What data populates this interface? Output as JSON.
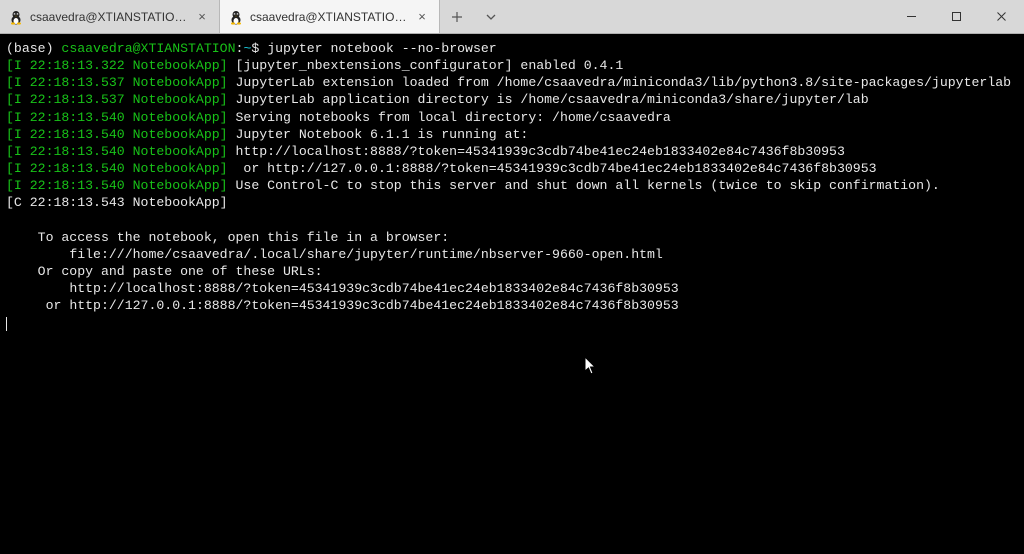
{
  "tabs": {
    "t0": {
      "title": "csaavedra@XTIANSTATION: /mr"
    },
    "t1": {
      "title": "csaavedra@XTIANSTATION: ~"
    }
  },
  "prompt": {
    "base": "(base)",
    "userhost": "csaavedra@XTIANSTATION",
    "colon": ":",
    "path": "~",
    "sigil": "$",
    "command": "jupyter notebook --no-browser"
  },
  "log": {
    "l1": {
      "prefix": "[I 22:18:13.322 NotebookApp]",
      "msg": " [jupyter_nbextensions_configurator] enabled 0.4.1"
    },
    "l2": {
      "prefix": "[I 22:18:13.537 NotebookApp]",
      "msg": " JupyterLab extension loaded from /home/csaavedra/miniconda3/lib/python3.8/site-packages/jupyterlab"
    },
    "l3": {
      "prefix": "[I 22:18:13.537 NotebookApp]",
      "msg": " JupyterLab application directory is /home/csaavedra/miniconda3/share/jupyter/lab"
    },
    "l4": {
      "prefix": "[I 22:18:13.540 NotebookApp]",
      "msg": " Serving notebooks from local directory: /home/csaavedra"
    },
    "l5": {
      "prefix": "[I 22:18:13.540 NotebookApp]",
      "msg": " Jupyter Notebook 6.1.1 is running at:"
    },
    "l6": {
      "prefix": "[I 22:18:13.540 NotebookApp]",
      "msg": " http://localhost:8888/?token=45341939c3cdb74be41ec24eb1833402e84c7436f8b30953"
    },
    "l7": {
      "prefix": "[I 22:18:13.540 NotebookApp]",
      "msg": "  or http://127.0.0.1:8888/?token=45341939c3cdb74be41ec24eb1833402e84c7436f8b30953"
    },
    "l8": {
      "prefix": "[I 22:18:13.540 NotebookApp]",
      "msg": " Use Control-C to stop this server and shut down all kernels (twice to skip confirmation)."
    },
    "l9": {
      "prefix": "[C 22:18:13.543 NotebookApp]",
      "msg": ""
    }
  },
  "tail": {
    "t1": "    To access the notebook, open this file in a browser:",
    "t2": "        file:///home/csaavedra/.local/share/jupyter/runtime/nbserver-9660-open.html",
    "t3": "    Or copy and paste one of these URLs:",
    "t4": "        http://localhost:8888/?token=45341939c3cdb74be41ec24eb1833402e84c7436f8b30953",
    "t5": "     or http://127.0.0.1:8888/?token=45341939c3cdb74be41ec24eb1833402e84c7436f8b30953"
  }
}
